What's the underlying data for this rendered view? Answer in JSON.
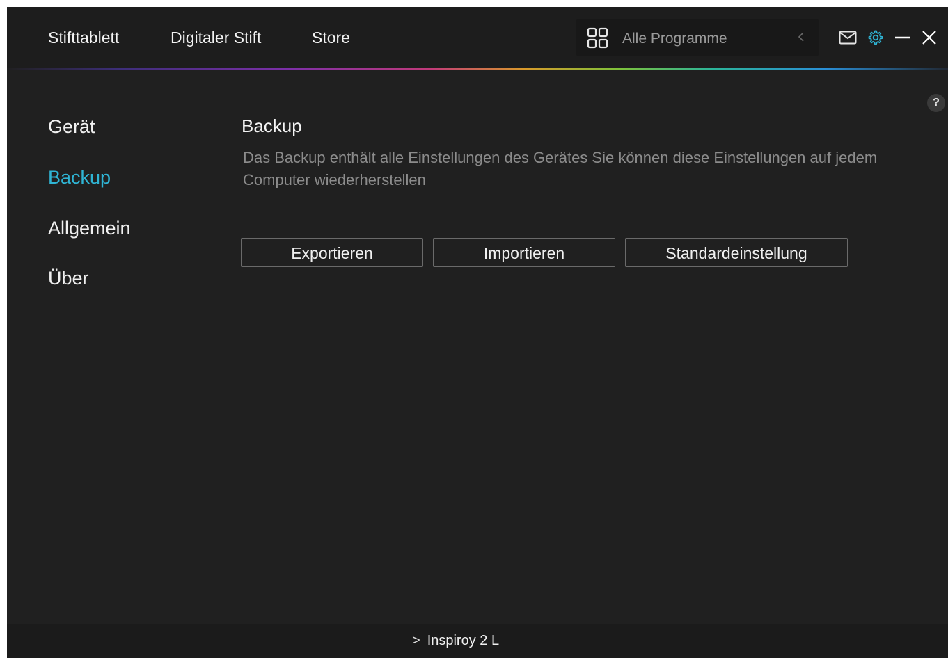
{
  "header": {
    "tabs": [
      {
        "label": "Stifttablett"
      },
      {
        "label": "Digitaler Stift"
      },
      {
        "label": "Store"
      }
    ],
    "app_selector": {
      "label": "Alle Programme",
      "icon": "app-grid-icon",
      "chevron": "chevron-left-icon"
    },
    "icons": {
      "mail": "mail-icon",
      "settings": "gear-icon",
      "minimize": "minimize-icon",
      "close": "close-icon"
    },
    "accent_color": "#2fb4d4"
  },
  "sidebar": {
    "items": [
      {
        "label": "Gerät",
        "active": false
      },
      {
        "label": "Backup",
        "active": true
      },
      {
        "label": "Allgemein",
        "active": false
      },
      {
        "label": "Über",
        "active": false
      }
    ]
  },
  "main": {
    "help_label": "?",
    "title": "Backup",
    "description": "Das Backup enthält alle Einstellungen des Gerätes Sie können diese Einstellungen auf jedem Computer wiederherstellen",
    "buttons": {
      "export": "Exportieren",
      "import": "Importieren",
      "default": "Standardeinstellung"
    }
  },
  "footer": {
    "device_arrow": ">",
    "device_name": "Inspiroy 2 L"
  }
}
